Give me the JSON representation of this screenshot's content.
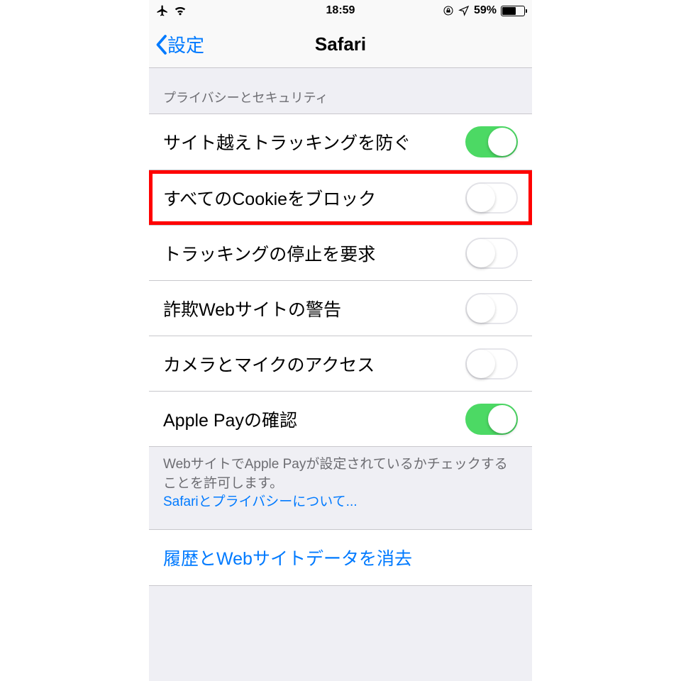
{
  "status": {
    "time": "18:59",
    "battery_pct": "59%"
  },
  "nav": {
    "back_label": "設定",
    "title": "Safari"
  },
  "section_header": "プライバシーとセキュリティ",
  "rows": {
    "prevent_tracking": {
      "label": "サイト越えトラッキングを防ぐ",
      "on": true
    },
    "block_cookies": {
      "label": "すべてのCookieをブロック",
      "on": false,
      "highlighted": true
    },
    "do_not_track": {
      "label": "トラッキングの停止を要求",
      "on": false
    },
    "fraud_warning": {
      "label": "詐欺Webサイトの警告",
      "on": false
    },
    "camera_mic": {
      "label": "カメラとマイクのアクセス",
      "on": false
    },
    "apple_pay": {
      "label": "Apple Payの確認",
      "on": true
    }
  },
  "footer": {
    "text": "WebサイトでApple Payが設定されているかチェックすることを許可します。",
    "link": "Safariとプライバシーについて..."
  },
  "clear_action": "履歴とWebサイトデータを消去"
}
